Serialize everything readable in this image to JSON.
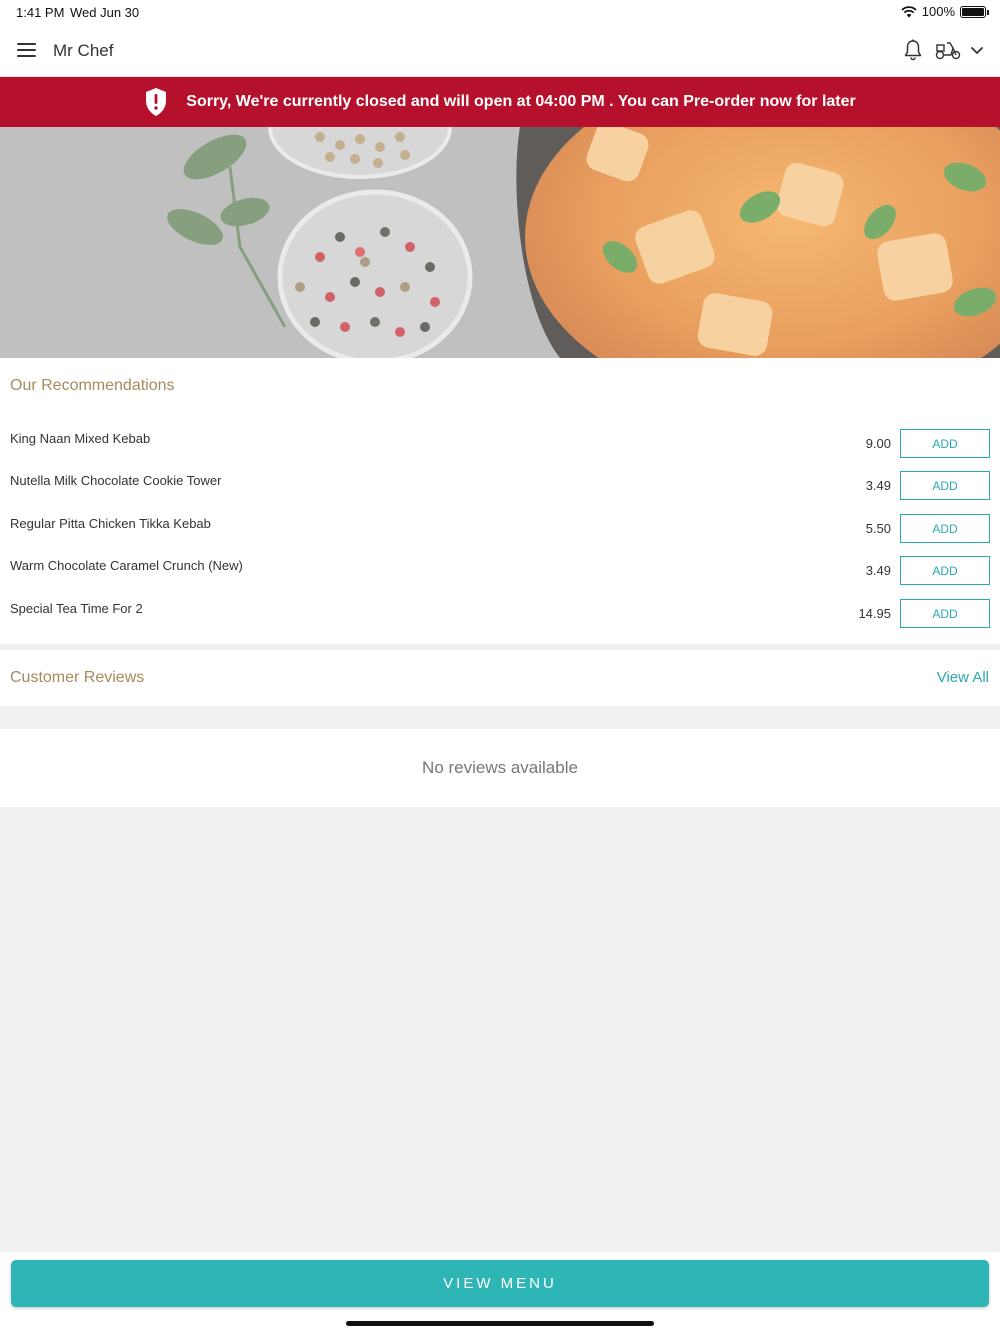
{
  "status_bar": {
    "time": "1:41 PM",
    "date": "Wed Jun 30",
    "battery": "100%"
  },
  "header": {
    "title": "Mr Chef"
  },
  "banner": {
    "text": "Sorry, We're currently closed and will open at 04:00 PM . You can Pre-order now for later",
    "color": "#b5112d"
  },
  "recommendations": {
    "title": "Our Recommendations",
    "add_label": "ADD",
    "items": [
      {
        "name": "King Naan Mixed Kebab",
        "price": "9.00"
      },
      {
        "name": "Nutella Milk Chocolate Cookie Tower",
        "price": "3.49"
      },
      {
        "name": "Regular Pitta Chicken Tikka Kebab",
        "price": "5.50"
      },
      {
        "name": "Warm Chocolate Caramel Crunch (New)",
        "price": "3.49"
      },
      {
        "name": "Special Tea Time For 2",
        "price": "14.95"
      }
    ]
  },
  "reviews": {
    "title": "Customer Reviews",
    "view_all": "View All",
    "empty_text": "No reviews available"
  },
  "bottom": {
    "view_menu": "VIEW MENU"
  },
  "colors": {
    "accent": "#2aa9b1",
    "section_title": "#a58b5d",
    "button": "#2eb5b5"
  },
  "icons": [
    "menu-icon",
    "bell-icon",
    "scooter-icon",
    "chevron-down-icon",
    "shield-alert-icon",
    "wifi-icon",
    "battery-icon"
  ]
}
